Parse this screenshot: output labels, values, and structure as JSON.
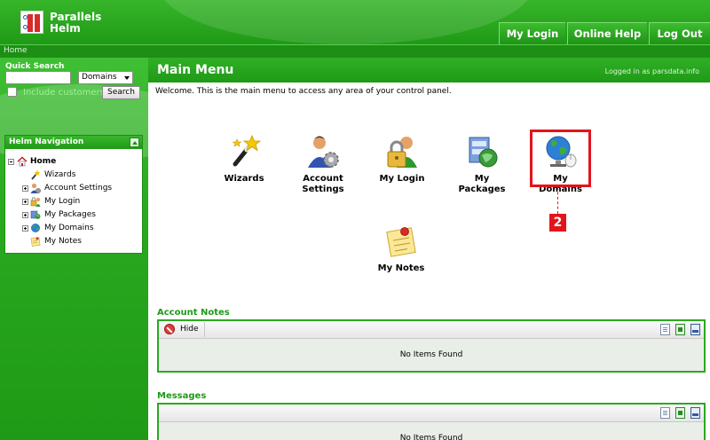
{
  "app": {
    "brand_line1": "Parallels",
    "brand_line2": "Helm"
  },
  "top_nav": {
    "my_login": "My Login",
    "online_help": "Online Help",
    "log_out": "Log Out"
  },
  "breadcrumb": {
    "home": "Home"
  },
  "quick_search": {
    "title": "Quick Search",
    "input_value": "",
    "scope_selected": "Domains",
    "include_customers": "Include customers.",
    "search_button": "Search"
  },
  "helm_navigation": {
    "title": "Helm Navigation",
    "items": [
      {
        "label": "Home",
        "icon": "home-icon",
        "expandable": false,
        "bold": true
      },
      {
        "label": "Wizards",
        "icon": "wizard-wand-icon",
        "expandable": false
      },
      {
        "label": "Account Settings",
        "icon": "account-settings-icon",
        "expandable": true
      },
      {
        "label": "My Login",
        "icon": "lock-user-icon",
        "expandable": true
      },
      {
        "label": "My Packages",
        "icon": "packages-icon",
        "expandable": true
      },
      {
        "label": "My Domains",
        "icon": "globe-icon",
        "expandable": true
      },
      {
        "label": "My Notes",
        "icon": "notes-icon",
        "expandable": false
      }
    ]
  },
  "main": {
    "title": "Main Menu",
    "logged_in": "Logged in as parsdata.info",
    "welcome": "Welcome. This is the main menu to access any area of your control panel."
  },
  "menu_items": {
    "wizards": "Wizards",
    "account_settings_1": "Account",
    "account_settings_2": "Settings",
    "my_login": "My Login",
    "my_packages": "My Packages",
    "my_domains": "My Domains",
    "my_notes": "My Notes"
  },
  "annotation": {
    "step": "2",
    "color": "#e4141b"
  },
  "account_notes": {
    "title": "Account Notes",
    "hide_button": "Hide",
    "empty": "No Items Found"
  },
  "messages": {
    "title": "Messages",
    "empty": "No Items Found"
  },
  "colors": {
    "brand_green": "#1f9a16",
    "header_green": "#37b52a",
    "annotation_red": "#e4141b"
  }
}
